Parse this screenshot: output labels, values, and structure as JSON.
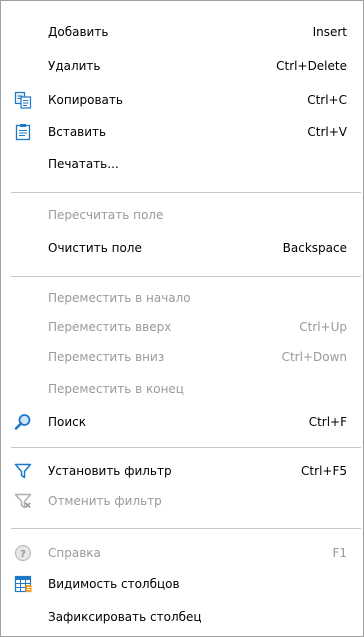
{
  "menu": {
    "items": [
      {
        "label": "Добавить",
        "shortcut": "Insert"
      },
      {
        "label": "Удалить",
        "shortcut": "Ctrl+Delete"
      },
      {
        "label": "Копировать",
        "shortcut": "Ctrl+C",
        "icon": "copy-icon"
      },
      {
        "label": "Вставить",
        "shortcut": "Ctrl+V",
        "icon": "paste-icon"
      },
      {
        "label": "Печатать...",
        "shortcut": ""
      },
      {
        "label": "Пересчитать поле",
        "shortcut": "",
        "disabled": true
      },
      {
        "label": "Очистить поле",
        "shortcut": "Backspace"
      },
      {
        "label": "Переместить в начало",
        "shortcut": "",
        "disabled": true
      },
      {
        "label": "Переместить вверх",
        "shortcut": "Ctrl+Up",
        "disabled": true
      },
      {
        "label": "Переместить вниз",
        "shortcut": "Ctrl+Down",
        "disabled": true
      },
      {
        "label": "Переместить в конец",
        "shortcut": "",
        "disabled": true
      },
      {
        "label": "Поиск",
        "shortcut": "Ctrl+F",
        "icon": "search-icon"
      },
      {
        "label": "Установить фильтр",
        "shortcut": "Ctrl+F5",
        "icon": "filter-icon"
      },
      {
        "label": "Отменить фильтр",
        "shortcut": "",
        "icon": "clear-filter-icon",
        "disabled": true
      },
      {
        "label": "Справка",
        "shortcut": "F1",
        "icon": "help-icon",
        "disabled": true
      },
      {
        "label": "Видимость столбцов",
        "shortcut": "",
        "icon": "columns-icon"
      },
      {
        "label": "Зафиксировать столбец",
        "shortcut": ""
      }
    ]
  },
  "colors": {
    "disabled_text": "#9a9a9a",
    "separator": "#c8c8c8",
    "accent_blue": "#1e78c8"
  }
}
